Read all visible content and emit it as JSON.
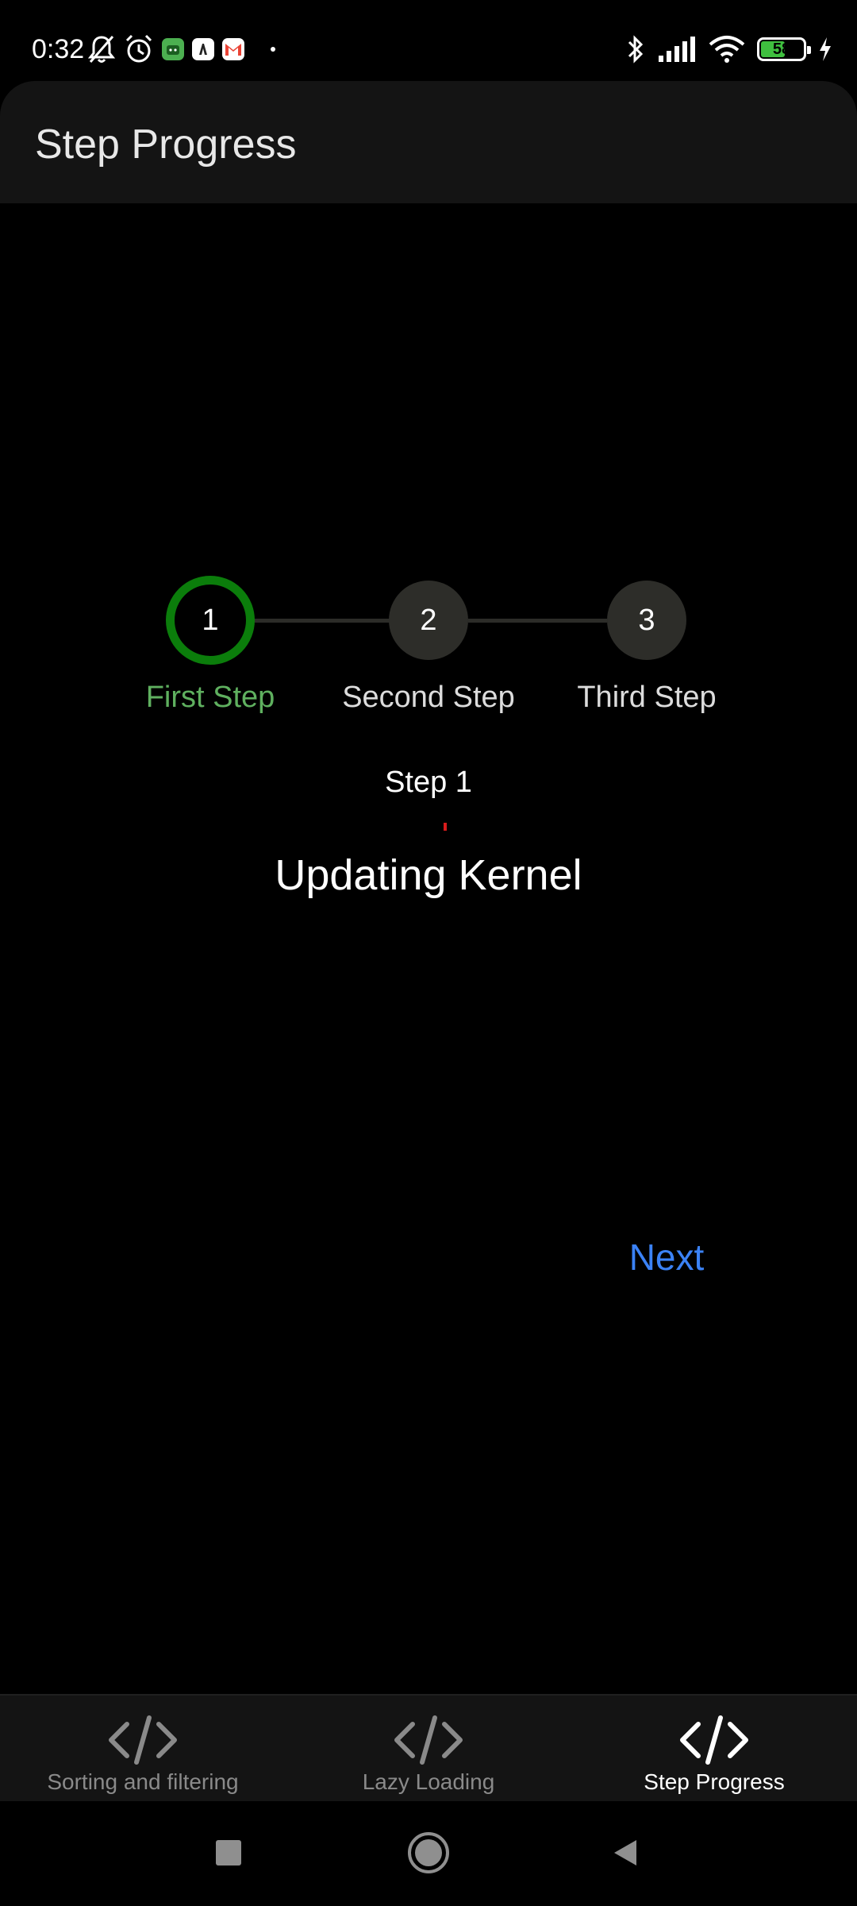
{
  "status_bar": {
    "time": "0:32",
    "battery_level": "58",
    "battery_fraction": 0.58,
    "left_icons": [
      "muted-bell-icon",
      "alarm-icon",
      "android-app-icon",
      "app-icon",
      "gmail-icon",
      "dot-icon"
    ],
    "right_icons": [
      "bluetooth-icon",
      "signal-icon",
      "wifi-icon",
      "battery-icon",
      "charging-icon"
    ]
  },
  "app_bar": {
    "title": "Step Progress"
  },
  "stepper": {
    "current_step": 1,
    "active_color": "#0b7d0b",
    "active_label_color": "#5fb05f",
    "inactive_color": "#2d2d29",
    "steps": [
      {
        "number": "1",
        "label": "First Step"
      },
      {
        "number": "2",
        "label": "Second Step"
      },
      {
        "number": "3",
        "label": "Third Step"
      }
    ],
    "step_title": "Step 1",
    "step_description": "Updating Kernel"
  },
  "actions": {
    "next_label": "Next",
    "next_color": "#3b82f6"
  },
  "bottom_nav": {
    "items": [
      {
        "label": "Sorting and filtering",
        "icon": "code-icon",
        "selected": false
      },
      {
        "label": "Lazy Loading",
        "icon": "code-icon",
        "selected": false
      },
      {
        "label": "Step Progress",
        "icon": "code-icon",
        "selected": true
      }
    ]
  },
  "system_nav": {
    "buttons": [
      "recents-button",
      "home-button",
      "back-button"
    ]
  }
}
